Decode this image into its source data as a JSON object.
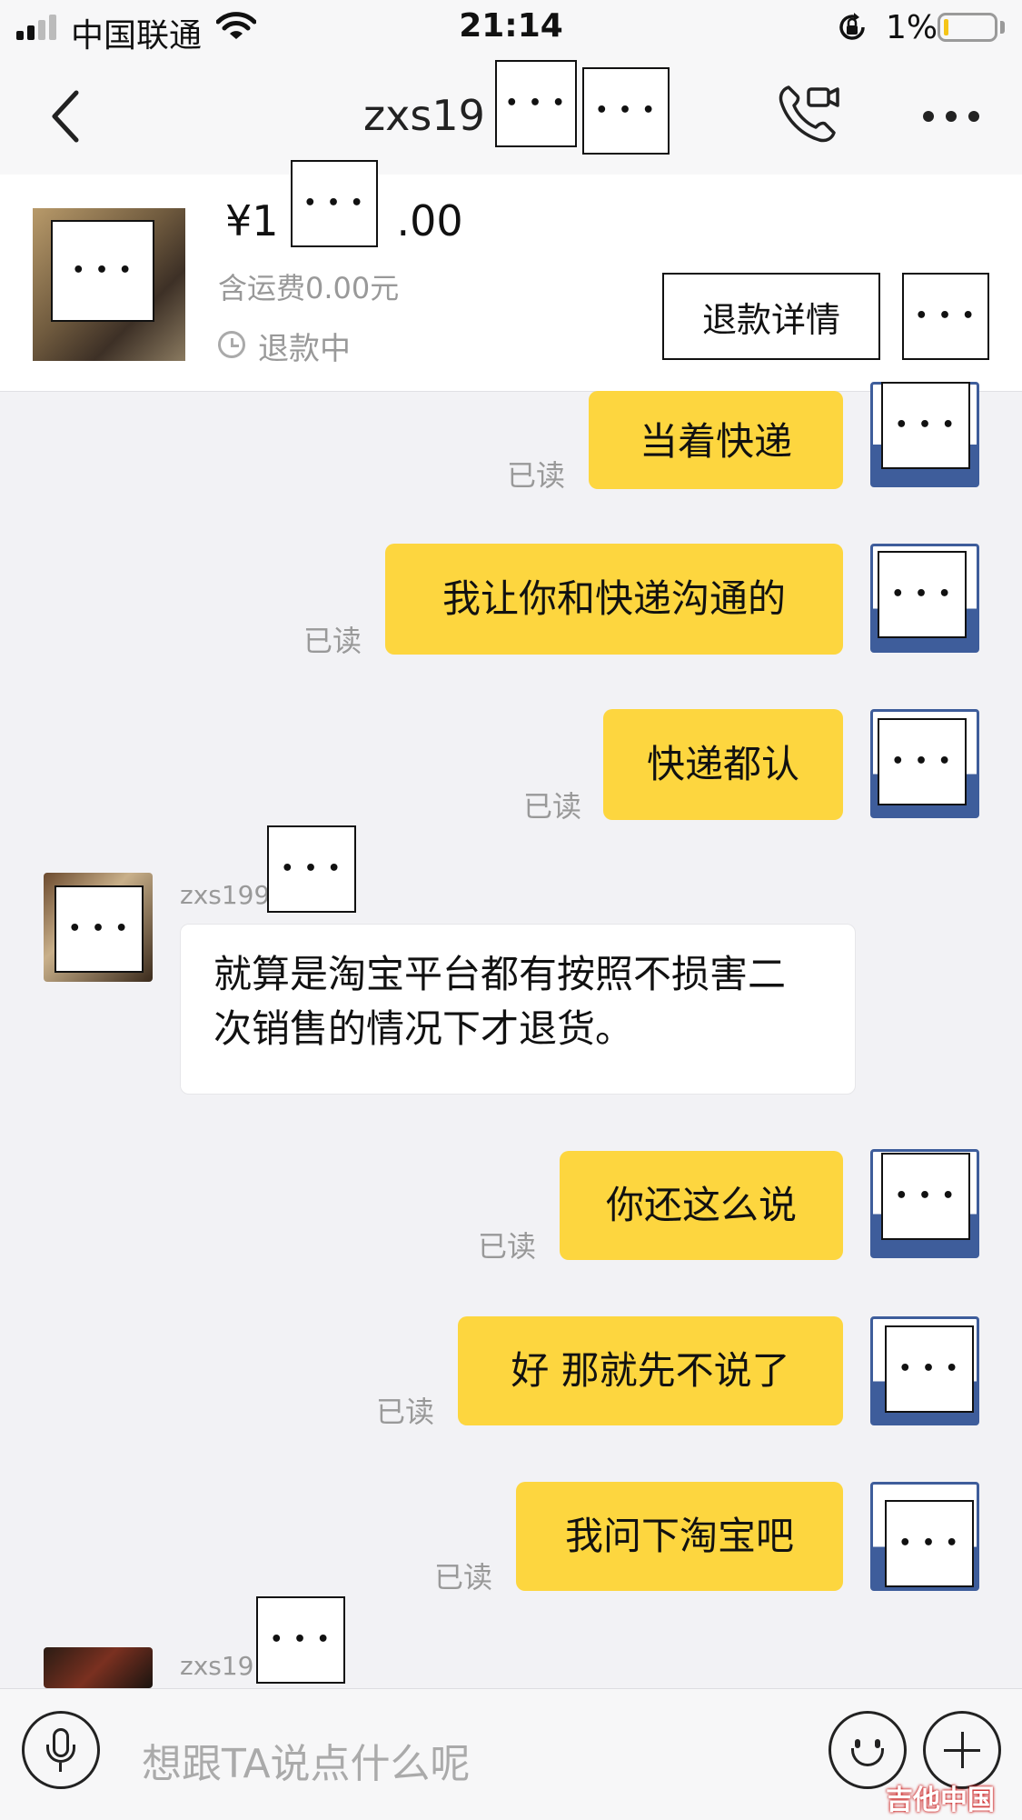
{
  "status_bar": {
    "carrier": "中国联通",
    "time": "21:14",
    "battery": "1%",
    "battery_level": 0.01,
    "signal_bars_filled": 2,
    "icons": [
      "signal-icon",
      "wifi-icon",
      "orientation-lock-icon",
      "battery-icon"
    ]
  },
  "nav": {
    "title": "zxs19",
    "icons": [
      "back-chevron-icon",
      "phone-video-icon",
      "more-icon"
    ]
  },
  "order": {
    "price": "¥1",
    "price_suffix": ".00",
    "shipping": "含运费0.00元",
    "status": "退款中",
    "refund_button": "退款详情"
  },
  "messages": [
    {
      "from": "me",
      "text": "当着快递",
      "read": "已读"
    },
    {
      "from": "me",
      "text": "我让你和快递沟通的",
      "read": "已读"
    },
    {
      "from": "me",
      "text": "快递都认",
      "read": "已读"
    },
    {
      "from": "them",
      "sender": "zxs199",
      "text": "就算是淘宝平台都有按照不损害二次销售的情况下才退货。"
    },
    {
      "from": "me",
      "text": "你还这么说",
      "read": "已读"
    },
    {
      "from": "me",
      "text": "好 那就先不说了",
      "read": "已读"
    },
    {
      "from": "me",
      "text": "我问下淘宝吧",
      "read": "已读"
    },
    {
      "from": "them",
      "sender": "zxs19"
    }
  ],
  "input": {
    "placeholder": "想跟TA说点什么呢",
    "icons": [
      "microphone-icon",
      "emoji-icon",
      "plus-icon"
    ]
  },
  "watermark": "吉他中国",
  "colors": {
    "my_bubble": "#fdd63f",
    "their_bubble": "#ffffff",
    "background": "#f2f2f5",
    "read_text": "#999999"
  }
}
